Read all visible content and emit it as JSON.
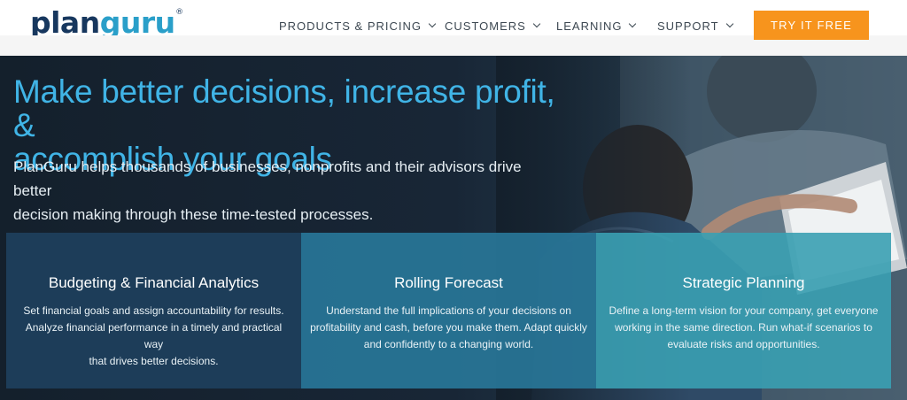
{
  "header": {
    "logo": {
      "part1": "plan",
      "part2": "guru",
      "mark": "®"
    },
    "nav": [
      {
        "label": "PRODUCTS & PRICING"
      },
      {
        "label": "CUSTOMERS"
      },
      {
        "label": "LEARNING"
      },
      {
        "label": "SUPPORT"
      }
    ],
    "cta_label": "TRY IT FREE"
  },
  "hero": {
    "headline_line1": "Make better decisions, increase profit, &",
    "headline_line2": "accomplish your goals",
    "lead_line1": "PlanGuru helps thousands of businesses, nonprofits and their advisors drive better",
    "lead_line2": "decision making through these time-tested processes."
  },
  "cards": [
    {
      "title": "Budgeting & Financial Analytics",
      "line1": "Set financial goals and assign accountability for results.",
      "line2": "Analyze financial performance in a timely and practical way",
      "line3": "that drives better decisions."
    },
    {
      "title": "Rolling Forecast",
      "line1": "Understand the full implications of your decisions on",
      "line2": "profitability and cash, before you make them. Adapt quickly",
      "line3": "and confidently to a changing world."
    },
    {
      "title": "Strategic Planning",
      "line1": "Define a long-term vision for your company, get everyone",
      "line2": "working in the same direction. Run what-if scenarios to",
      "line3": "evaluate risks and opportunities."
    }
  ],
  "colors": {
    "brand_navy": "#17375e",
    "brand_blue": "#2a9fc9",
    "cta_orange": "#f7941d",
    "headline_blue": "#40b4e6"
  },
  "icons": [
    "chevron-down-icon"
  ]
}
